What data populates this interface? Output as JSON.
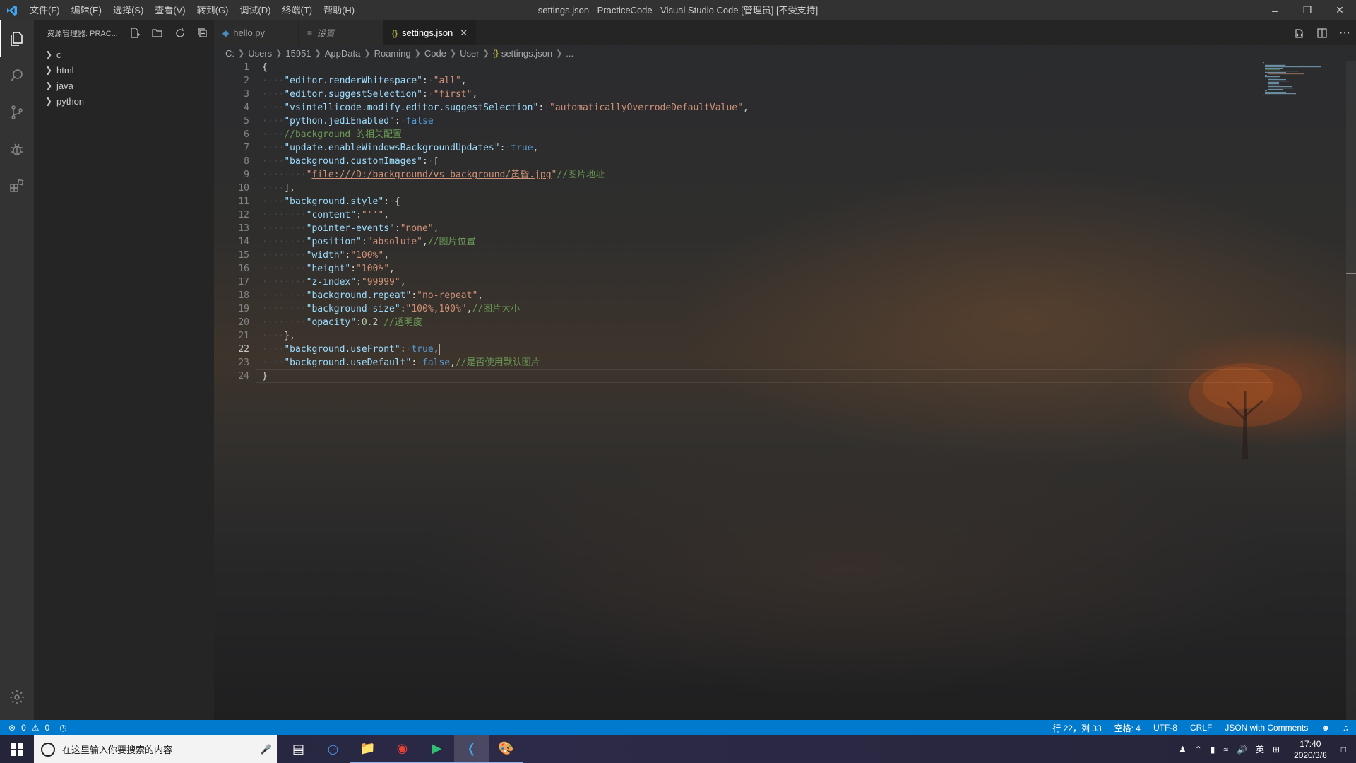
{
  "titlebar": {
    "menu": [
      "文件(F)",
      "编辑(E)",
      "选择(S)",
      "查看(V)",
      "转到(G)",
      "调试(D)",
      "终端(T)",
      "帮助(H)"
    ],
    "title": "settings.json - PracticeCode - Visual Studio Code [管理员] [不受支持]"
  },
  "sidebar": {
    "title": "资源管理器: PRAC...",
    "items": [
      {
        "label": "c"
      },
      {
        "label": "html"
      },
      {
        "label": "java"
      },
      {
        "label": "python"
      }
    ]
  },
  "tabs": [
    {
      "label": "hello.py",
      "icon": "python-icon"
    },
    {
      "label": "设置",
      "icon": "settings-lines-icon"
    },
    {
      "label": "settings.json",
      "icon": "json-braces-icon",
      "active": true
    }
  ],
  "breadcrumb": [
    "C:",
    "Users",
    "15951",
    "AppData",
    "Roaming",
    "Code",
    "User",
    "settings.json",
    "..."
  ],
  "editor": {
    "current_line": 22,
    "lines": [
      "{",
      "\"editor.renderWhitespace\": \"all\",",
      "\"editor.suggestSelection\": \"first\",",
      "\"vsintellicode.modify.editor.suggestSelection\": \"automaticallyOverrodeDefaultValue\",",
      "\"python.jediEnabled\": false",
      "//background 的相关配置",
      "\"update.enableWindowsBackgroundUpdates\": true,",
      "\"background.customImages\": [",
      "\"file:///D:/background/vs_background/黄昏.jpg\"//图片地址",
      "],",
      "\"background.style\": {",
      "\"content\":\"''\",",
      "\"pointer-events\":\"none\",",
      "\"position\":\"absolute\",//图片位置",
      "\"width\":\"100%\",",
      "\"height\":\"100%\",",
      "\"z-index\":\"99999\",",
      "\"background.repeat\":\"no-repeat\",",
      "\"background-size\":\"100%,100%\",//图片大小",
      "\"opacity\":0.2 //透明度",
      "},",
      "\"background.useFront\": true,",
      "\"background.useDefault\": false,//是否使用默认图片",
      "}"
    ]
  },
  "status": {
    "errors": "0",
    "warnings": "0",
    "position": "行 22，列 33",
    "indent": "空格: 4",
    "encoding": "UTF-8",
    "eol": "CRLF",
    "language": "JSON with Comments"
  },
  "taskbar": {
    "search_placeholder": "在这里输入你要搜索的内容",
    "ime": "英",
    "time": "17:40",
    "date": "2020/3/8"
  },
  "colors": {
    "statusbar": "#007acc",
    "key": "#9cdcfe",
    "string": "#ce9178",
    "keyword": "#569cd6",
    "number": "#b5cea8",
    "comment": "#6a9955"
  }
}
